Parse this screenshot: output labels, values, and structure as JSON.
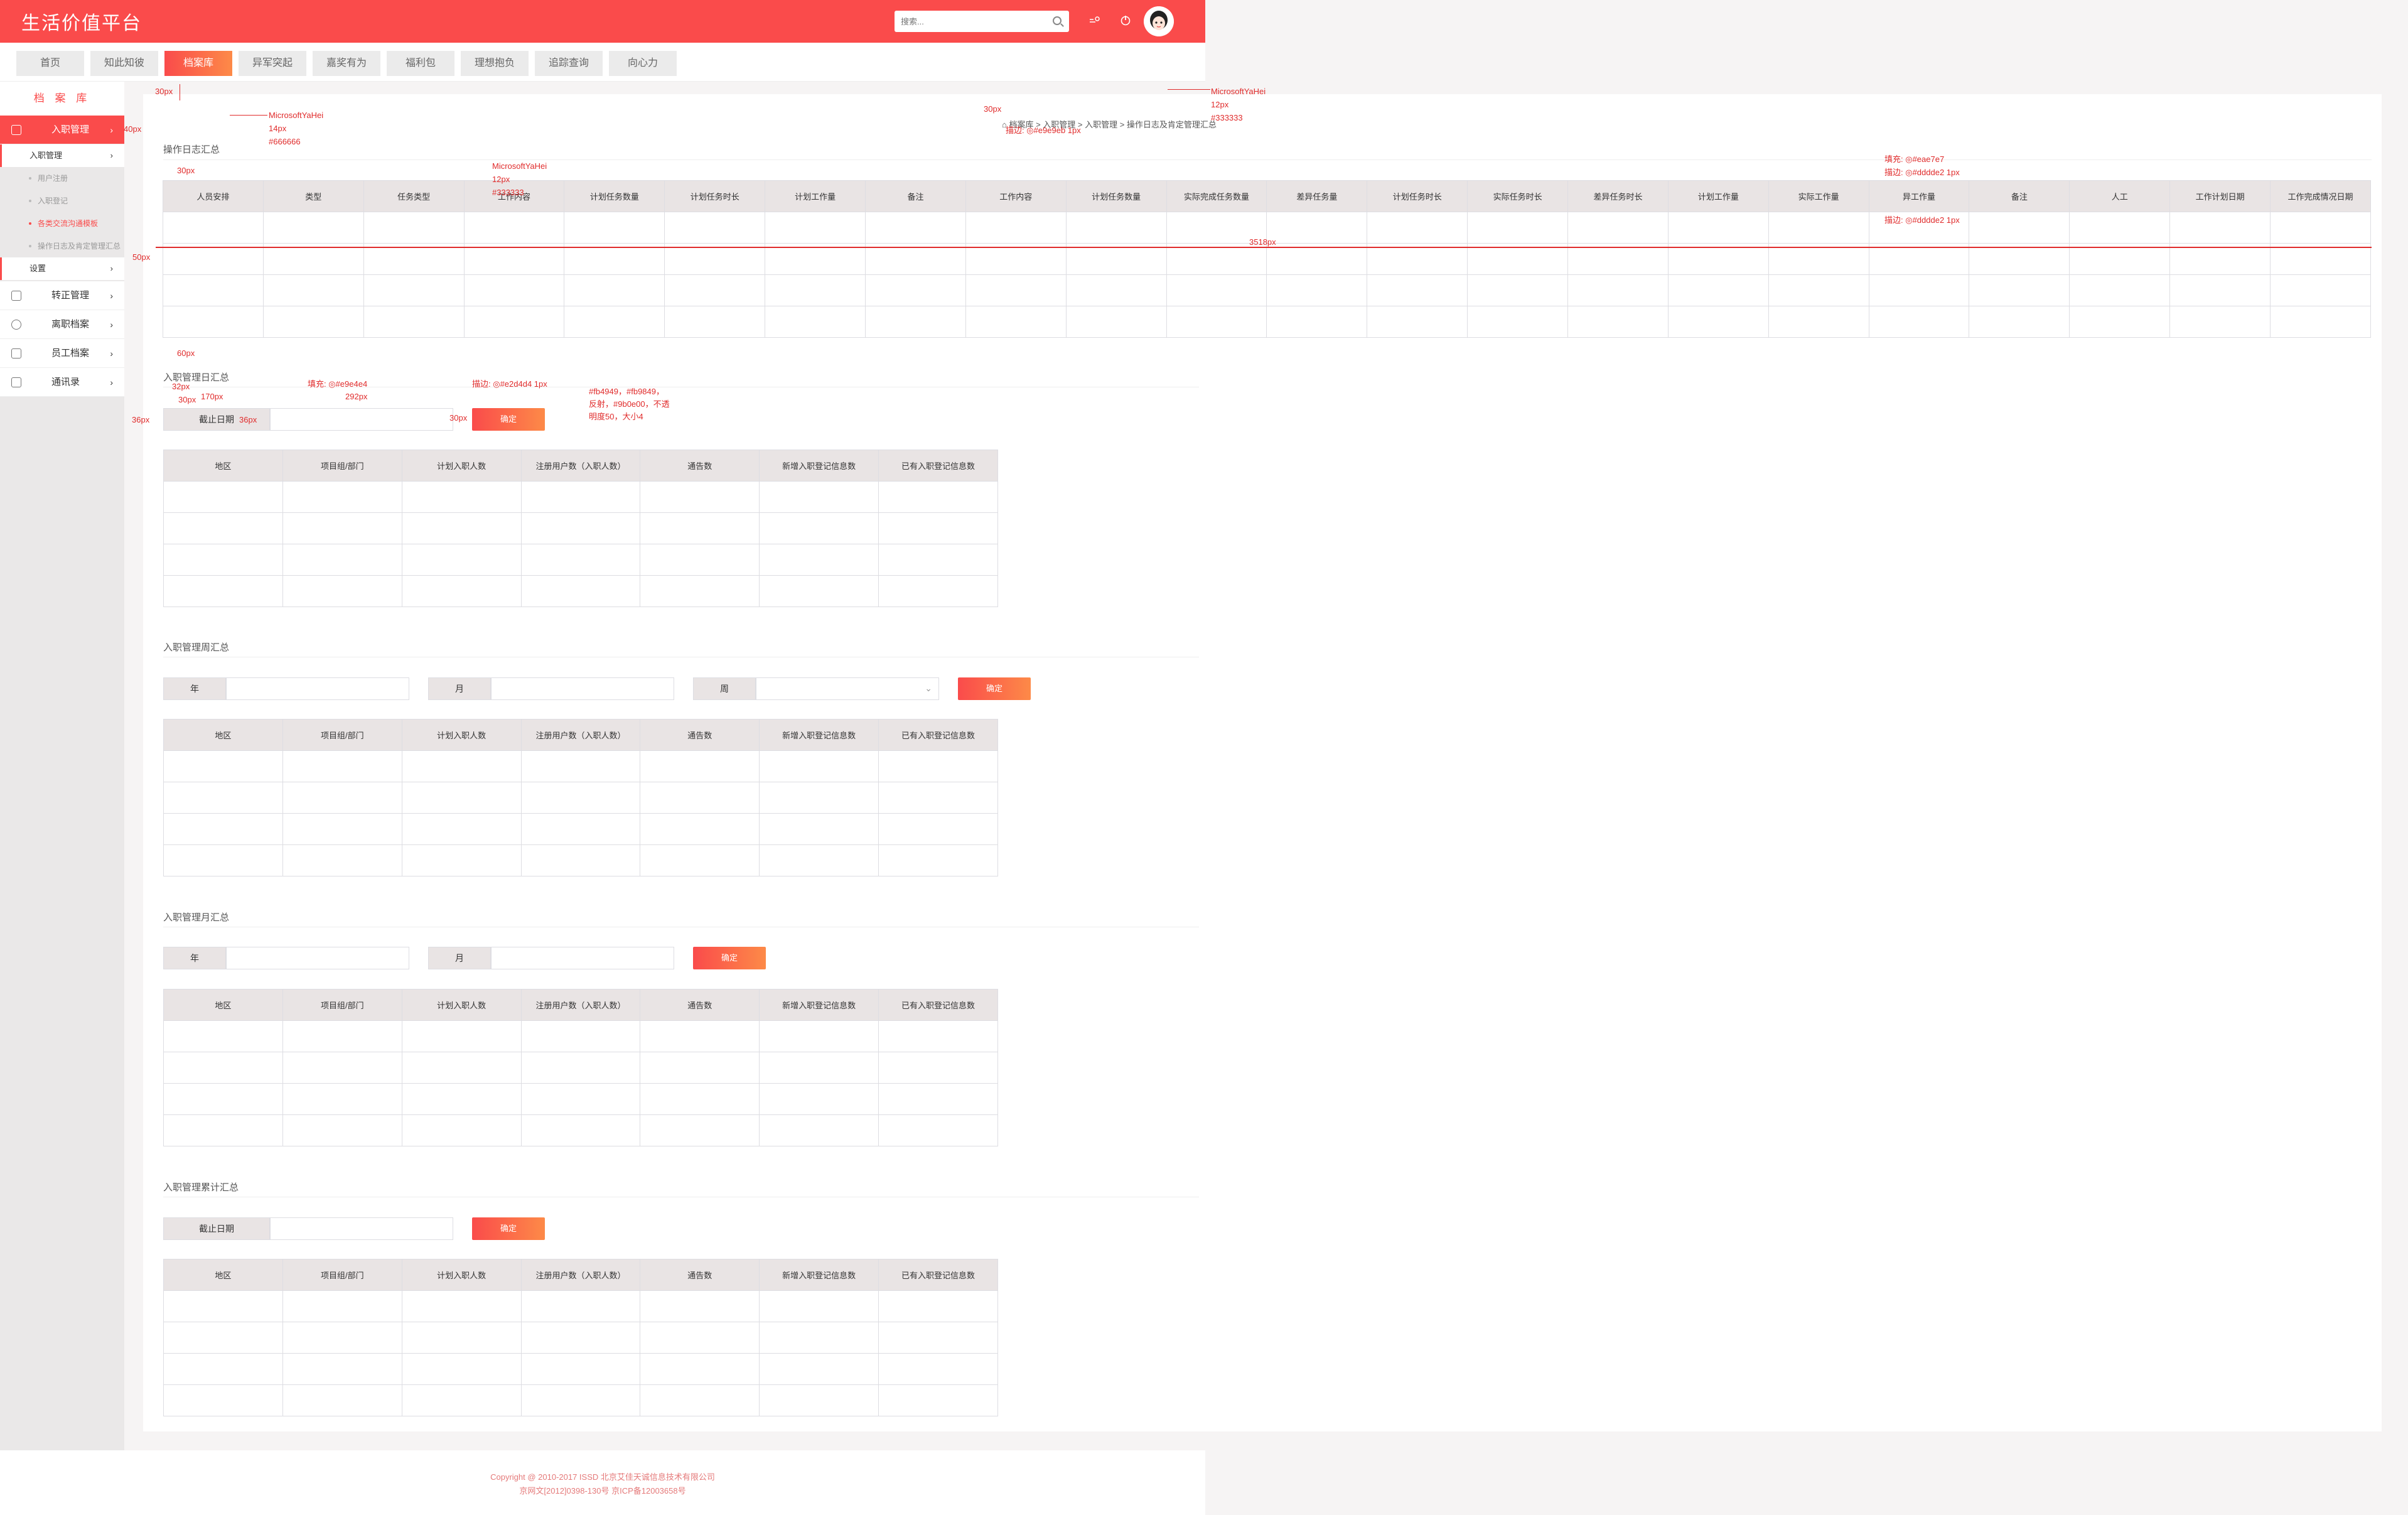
{
  "header": {
    "logo": "生活价值平台",
    "search_placeholder": "搜索...",
    "icons": [
      "notification-icon",
      "power-icon"
    ]
  },
  "nav": {
    "tabs": [
      "首页",
      "知此知彼",
      "档案库",
      "异军突起",
      "嘉奖有为",
      "福利包",
      "理想抱负",
      "追踪查询",
      "向心力"
    ],
    "active_index": 2
  },
  "sidebar": {
    "title": "档 案 库",
    "main_items": [
      {
        "label": "入职管理",
        "icon": "profile-card-icon",
        "active": true
      },
      {
        "label": "转正管理",
        "icon": "document-icon"
      },
      {
        "label": "离职档案",
        "icon": "user-icon"
      },
      {
        "label": "员工档案",
        "icon": "archive-icon"
      },
      {
        "label": "通讯录",
        "icon": "contacts-icon"
      }
    ],
    "sub_group": "入职管理",
    "leaves": [
      {
        "label": "用户注册"
      },
      {
        "label": "入职登记"
      },
      {
        "label": "各类交流沟通模板",
        "active": true
      },
      {
        "label": "操作日志及肯定管理汇总"
      }
    ],
    "settings": "设置"
  },
  "main": {
    "breadcrumb": "档案库 > 入职管理 > 入职管理 > 操作日志及肯定管理汇总",
    "operation_log": {
      "title": "操作日志汇总",
      "columns": [
        "人员安排",
        "类型",
        "任务类型",
        "工作内容",
        "计划任务数量",
        "计划任务时长",
        "计划工作量",
        "备注",
        "工作内容",
        "计划任务数量",
        "实际完成任务数量",
        "差异任务量",
        "计划任务时长",
        "实际任务时长",
        "差异任务时长",
        "计划工作量",
        "实际工作量",
        "异工作量",
        "备注",
        "人工",
        "工作计划日期",
        "工作完成情况日期"
      ],
      "rows": 4
    },
    "stat_columns": [
      "地区",
      "项目组/部门",
      "计划入职人数",
      "注册用户数（入职人数）",
      "通告数",
      "新增入职登记信息数",
      "已有入职登记信息数"
    ],
    "daily": {
      "title": "入职管理日汇总",
      "date_label": "截止日期",
      "confirm": "确定"
    },
    "weekly": {
      "title": "入职管理周汇总",
      "year_label": "年",
      "month_label": "月",
      "week_label": "周",
      "confirm": "确定"
    },
    "monthly": {
      "title": "入职管理月汇总",
      "year_label": "年",
      "month_label": "月",
      "confirm": "确定"
    },
    "cumulative": {
      "title": "入职管理累计汇总",
      "date_label": "截止日期",
      "confirm": "确定"
    }
  },
  "annotations": {
    "top_30": "30px",
    "sidebar_40": "40px",
    "title_font_1": "MicrosoftYaHei",
    "title_font_size_1": "14px",
    "title_color_1": "#666666",
    "gap_30": "30px",
    "header_font": "MicrosoftYaHei",
    "header_font_size": "12px",
    "header_color": "#333333",
    "bc_30": "30px",
    "bc_border": "描边: ◎#e9e9eb 1px",
    "bc_font": "MicrosoftYaHei",
    "bc_font_size": "12px",
    "bc_color": "#333333",
    "fill_th": "填充: ◎#eae7e7",
    "stroke_th": "描边: ◎#dddde2 1px",
    "stroke_td": "描边: ◎#dddde2 1px",
    "row_50": "50px",
    "width_3518": "3518px",
    "gap_60": "60px",
    "fill_label": "填充: ◎#e9e4e4",
    "stroke_input": "描边: ◎#e2d4d4 1px",
    "btn_gradient": "#fb4949，#fb9849，\n反射，#9b0e00，不透\n明度50，大小4",
    "h_32": "32px",
    "w_170": "170px",
    "w_292": "292px",
    "h_30": "30px",
    "h_36": "36px",
    "h_36b": "36px",
    "gap_30b": "30px"
  },
  "footer": {
    "copyright": "Copyright @ 2010-2017 ISSD 北京艾佳天诚信息技术有限公司",
    "icp": "京网文[2012]0398-130号        京ICP备12003658号"
  },
  "colors": {
    "brand": "#fa4b4b",
    "brand_gradient_end": "#fd8a48",
    "table_header": "#e9e4e4",
    "border": "#dddde2",
    "annotation": "#e02b2b"
  }
}
